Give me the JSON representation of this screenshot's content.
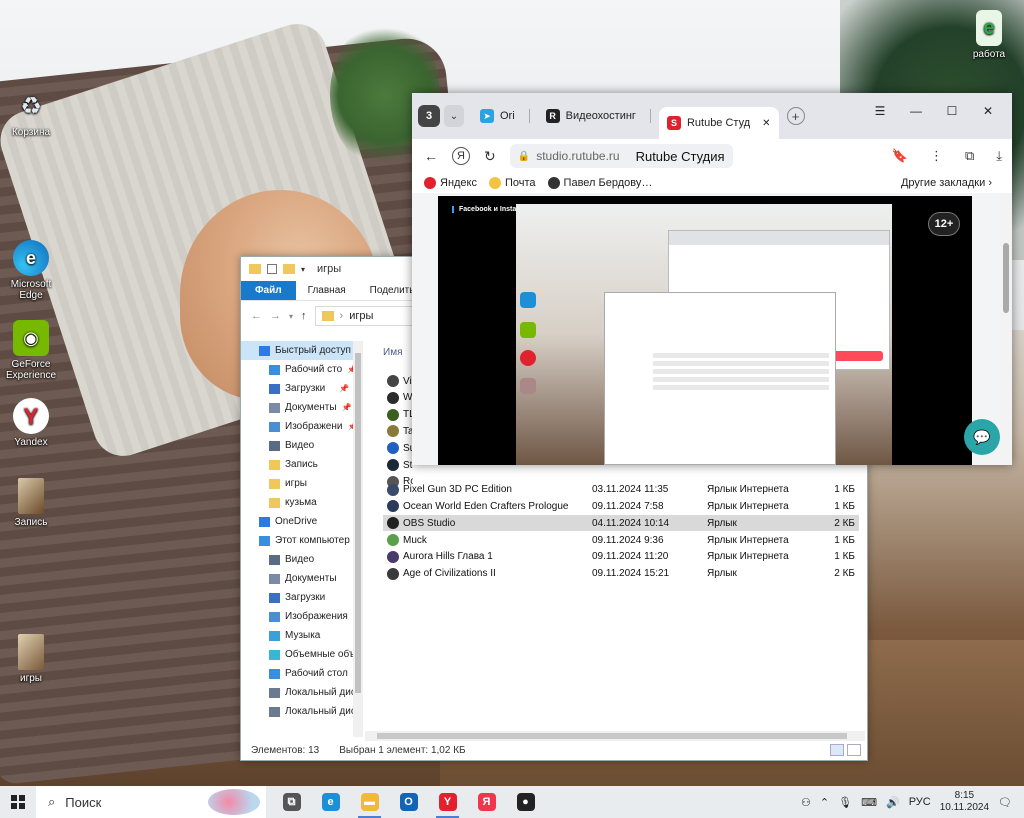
{
  "desktop": {
    "icons": [
      {
        "label": "Корзина",
        "icon": "recycle-bin-icon"
      },
      {
        "label": "Microsoft Edge",
        "icon": "edge-icon"
      },
      {
        "label": "GeForce Experience",
        "icon": "nvidia-icon"
      },
      {
        "label": "Yandex",
        "icon": "yandex-browser-icon"
      },
      {
        "label": "Запись",
        "icon": "shortcut-icon"
      },
      {
        "label": "игры",
        "icon": "shortcut-icon"
      },
      {
        "label": "работа",
        "icon": "edge-shortcut-icon"
      }
    ]
  },
  "explorer": {
    "title": "игры",
    "ribbon": {
      "file": "Файл",
      "home": "Главная",
      "share": "Поделиться"
    },
    "address": {
      "separator": "›",
      "path": "игры"
    },
    "column_name": "Имя",
    "nav": [
      {
        "label": "Быстрый доступ",
        "indent": 0,
        "selected": true,
        "color": "#2a7be4"
      },
      {
        "label": "Рабочий сто",
        "indent": 1,
        "pin": true,
        "color": "#3a8ee0"
      },
      {
        "label": "Загрузки",
        "indent": 1,
        "pin": true,
        "color": "#3a6fc4"
      },
      {
        "label": "Документы",
        "indent": 1,
        "pin": true,
        "color": "#7b8aa6"
      },
      {
        "label": "Изображени",
        "indent": 1,
        "pin": true,
        "color": "#4b8fd1"
      },
      {
        "label": "Видео",
        "indent": 1,
        "pin": false,
        "color": "#5a6b84"
      },
      {
        "label": "Запись",
        "indent": 1,
        "pin": false,
        "color": "#f0c75a"
      },
      {
        "label": "игры",
        "indent": 1,
        "pin": false,
        "color": "#f0c75a"
      },
      {
        "label": "кузьма",
        "indent": 1,
        "pin": false,
        "color": "#f0c75a"
      },
      {
        "label": "OneDrive",
        "indent": 0,
        "pin": false,
        "color": "#2a7be4"
      },
      {
        "label": "Этот компьютер",
        "indent": 0,
        "pin": false,
        "color": "#3a8ee0"
      },
      {
        "label": "Видео",
        "indent": 1,
        "pin": false,
        "color": "#5a6b84"
      },
      {
        "label": "Документы",
        "indent": 1,
        "pin": false,
        "color": "#7b8aa6"
      },
      {
        "label": "Загрузки",
        "indent": 1,
        "pin": false,
        "color": "#3a6fc4"
      },
      {
        "label": "Изображения",
        "indent": 1,
        "pin": false,
        "color": "#4b8fd1"
      },
      {
        "label": "Музыка",
        "indent": 1,
        "pin": false,
        "color": "#3aa0d8"
      },
      {
        "label": "Объемные объ",
        "indent": 1,
        "pin": false,
        "color": "#39b6d6"
      },
      {
        "label": "Рабочий стол",
        "indent": 1,
        "pin": false,
        "color": "#3a8ee0"
      },
      {
        "label": "Локальный дис",
        "indent": 1,
        "pin": false,
        "color": "#6b7a90"
      },
      {
        "label": "Локальный дис",
        "indent": 1,
        "pin": false,
        "color": "#6b7a90"
      }
    ],
    "files_hidden": [
      {
        "name": "Vid",
        "color": "#444"
      },
      {
        "name": "Wa",
        "color": "#2b2b2b"
      },
      {
        "name": "TL",
        "color": "#3a5f1f"
      },
      {
        "name": "Tan",
        "color": "#8a7a3a"
      },
      {
        "name": "Sup",
        "color": "#2060c0"
      },
      {
        "name": "Ste",
        "color": "#1b2838"
      },
      {
        "name": "Rob",
        "color": "#555"
      }
    ],
    "files": [
      {
        "name": "Pixel Gun 3D PC Edition",
        "date": "03.11.2024 11:35",
        "type": "Ярлык Интернета",
        "size": "1 КБ",
        "color": "#3a4a6a",
        "selected": false
      },
      {
        "name": "Ocean World Eden Crafters Prologue",
        "date": "09.11.2024 7:58",
        "type": "Ярлык Интернета",
        "size": "1 КБ",
        "color": "#2a3a5a",
        "selected": false
      },
      {
        "name": "OBS Studio",
        "date": "04.11.2024 10:14",
        "type": "Ярлык",
        "size": "2 КБ",
        "color": "#222",
        "selected": true
      },
      {
        "name": "Muck",
        "date": "09.11.2024 9:36",
        "type": "Ярлык Интернета",
        "size": "1 КБ",
        "color": "#5aa04a",
        "selected": false
      },
      {
        "name": "Aurora Hills  Глава 1",
        "date": "09.11.2024 11:20",
        "type": "Ярлык Интернета",
        "size": "1 КБ",
        "color": "#4a3a6a",
        "selected": false
      },
      {
        "name": "Age of Civilizations II",
        "date": "09.11.2024 15:21",
        "type": "Ярлык",
        "size": "2 КБ",
        "color": "#3a3a3a",
        "selected": false
      }
    ],
    "status": {
      "count": "Элементов: 13",
      "selection": "Выбран 1 элемент: 1,02 КБ"
    }
  },
  "browser": {
    "tab_count": "3",
    "tabs": [
      {
        "label": "Ori ",
        "fav_color": "#2aa3e0",
        "fav_glyph": "➤",
        "active": false
      },
      {
        "label": "Видеохостинг",
        "fav_color": "#222",
        "fav_glyph": "R",
        "active": false
      },
      {
        "label": "Rutube Студ",
        "fav_color": "#e0222f",
        "fav_glyph": "S",
        "active": true
      }
    ],
    "url_host": "studio.rutube.ru",
    "page_title": "Rutube Студия",
    "bookmarks": [
      {
        "label": "Яндекс",
        "color": "#e0222f"
      },
      {
        "label": "Почта",
        "color": "#f5c342"
      },
      {
        "label": "Павел Бердову…",
        "color": "#333"
      }
    ],
    "other_bookmarks": "Другие закладки",
    "player": {
      "banner": "Facebook и Instagram запрещены в РФ",
      "age": "12+"
    }
  },
  "taskbar": {
    "search_placeholder": "Поиск",
    "apps": [
      {
        "name": "task-view-icon",
        "color": "#555",
        "glyph": "⧉",
        "active": false
      },
      {
        "name": "edge-icon",
        "color": "#1d8fd6",
        "glyph": "e",
        "active": false
      },
      {
        "name": "file-explorer-icon",
        "color": "#f0b93a",
        "glyph": "▬",
        "active": true
      },
      {
        "name": "outlook-icon",
        "color": "#1464b4",
        "glyph": "O",
        "active": false
      },
      {
        "name": "yandex-browser-icon",
        "color": "#e0222f",
        "glyph": "Y",
        "active": true
      },
      {
        "name": "yandex-icon",
        "color": "#f0364a",
        "glyph": "Я",
        "active": false
      },
      {
        "name": "obs-icon",
        "color": "#222",
        "glyph": "●",
        "active": false
      }
    ],
    "lang": "РУС",
    "time": "8:15",
    "date": "10.11.2024"
  }
}
